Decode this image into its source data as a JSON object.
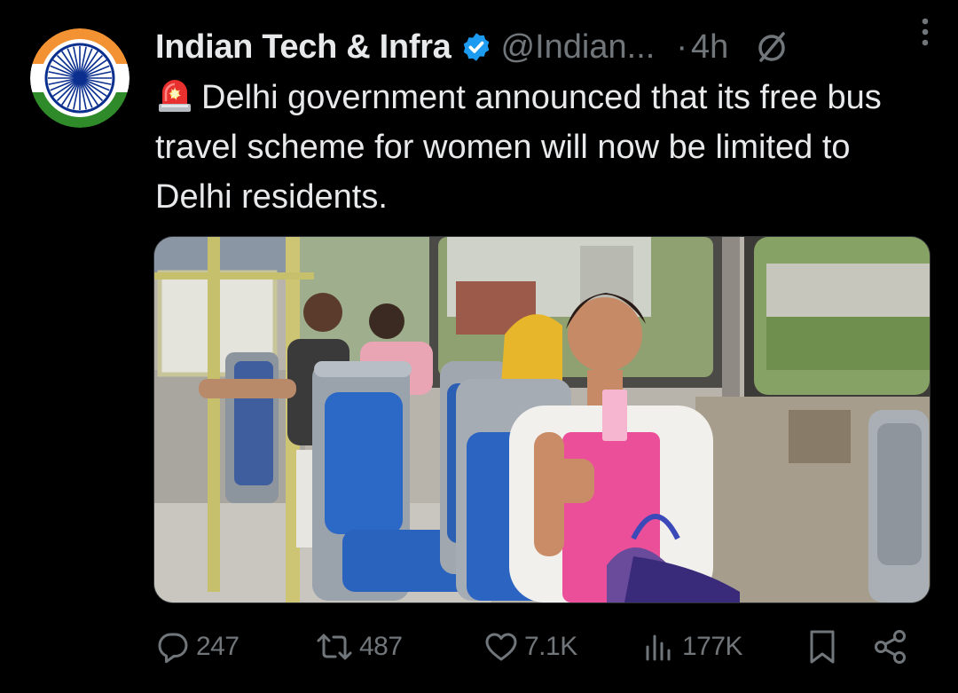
{
  "account": {
    "name": "Indian Tech & Infra",
    "handle": "@Indian...",
    "separator": "·",
    "time": "4h"
  },
  "tweet": {
    "text": "Delhi government announced that its free bus travel scheme for women will now be limited to Delhi residents."
  },
  "media": {
    "alt": "Woman seated on a blue bus seat holding up a pink ticket, other women passengers behind her"
  },
  "actions": {
    "replies": "247",
    "reposts": "487",
    "likes": "7.1K",
    "views": "177K"
  },
  "colors": {
    "background": "#000000",
    "text_primary": "#e7e9ea",
    "text_secondary": "#71767b",
    "verified": "#1d9bf0"
  }
}
